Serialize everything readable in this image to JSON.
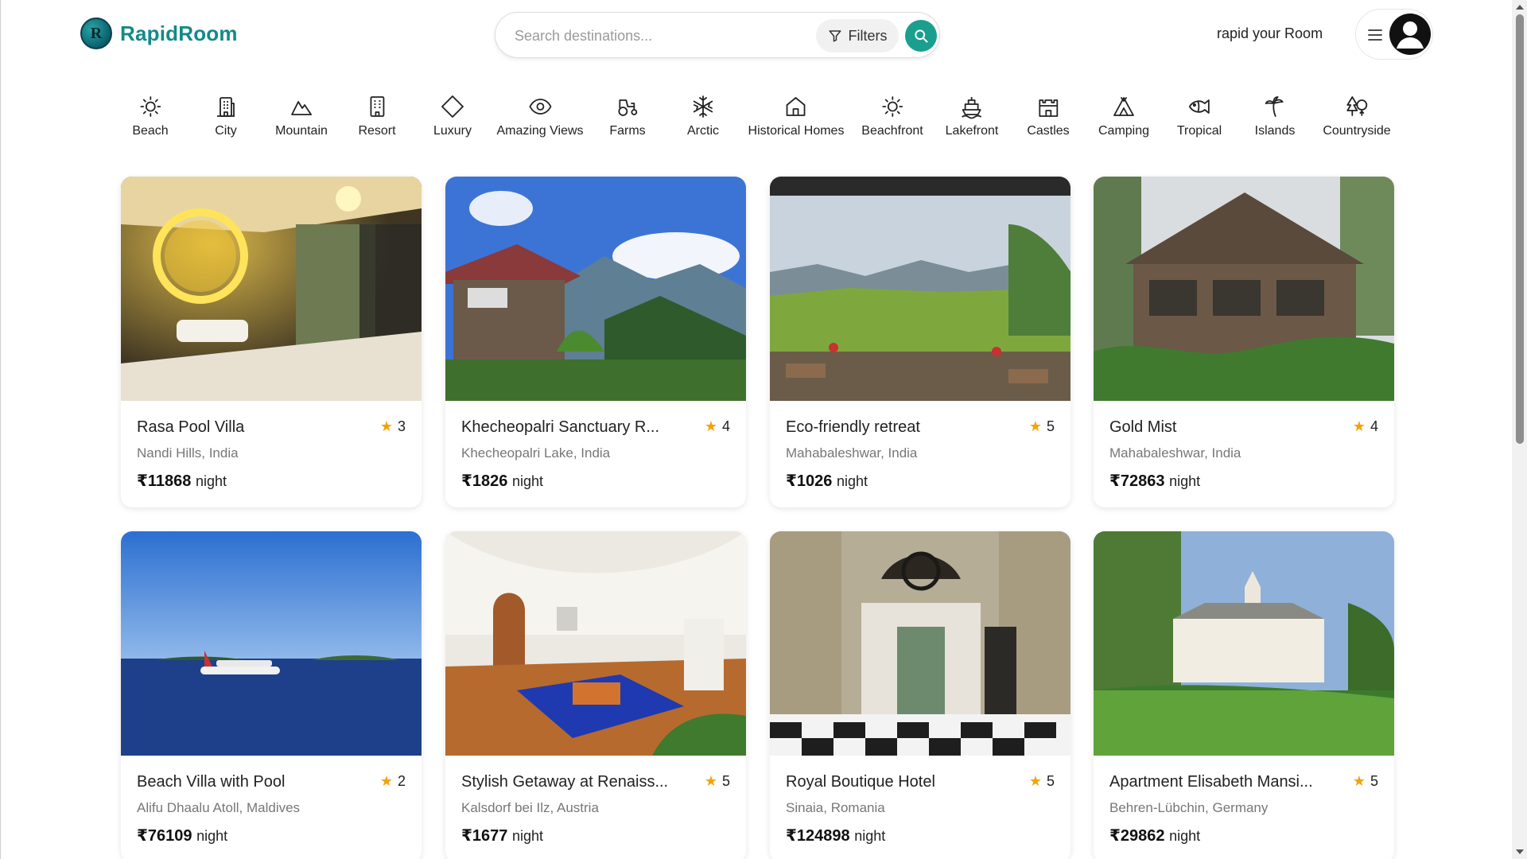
{
  "brand": {
    "name": "RapidRoom",
    "logo_letter": "R"
  },
  "search": {
    "placeholder": "Search destinations...",
    "filters_label": "Filters"
  },
  "header": {
    "tagline": "rapid your Room"
  },
  "categories": [
    {
      "label": "Beach",
      "icon": "sun-icon"
    },
    {
      "label": "City",
      "icon": "building-icon"
    },
    {
      "label": "Mountain",
      "icon": "mountain-icon"
    },
    {
      "label": "Resort",
      "icon": "hotel-icon"
    },
    {
      "label": "Luxury",
      "icon": "diamond-icon"
    },
    {
      "label": "Amazing Views",
      "icon": "eye-icon"
    },
    {
      "label": "Farms",
      "icon": "tractor-icon"
    },
    {
      "label": "Arctic",
      "icon": "snowflake-icon"
    },
    {
      "label": "Historical Homes",
      "icon": "home-icon"
    },
    {
      "label": "Beachfront",
      "icon": "sun-icon"
    },
    {
      "label": "Lakefront",
      "icon": "ship-icon"
    },
    {
      "label": "Castles",
      "icon": "castle-icon"
    },
    {
      "label": "Camping",
      "icon": "tent-icon"
    },
    {
      "label": "Tropical",
      "icon": "fish-icon"
    },
    {
      "label": "Islands",
      "icon": "palm-tree-icon"
    },
    {
      "label": "Countryside",
      "icon": "trees-icon"
    }
  ],
  "listings": [
    {
      "title": "Rasa Pool Villa",
      "location": "Nandi Hills, India",
      "price": "₹11868",
      "unit": "night",
      "rating": "3",
      "scene": "bathroom"
    },
    {
      "title": "Khecheopalri Sanctuary R...",
      "location": "Khecheopalri Lake, India",
      "price": "₹1826",
      "unit": "night",
      "rating": "4",
      "scene": "mountain-house"
    },
    {
      "title": "Eco-friendly retreat",
      "location": "Mahabaleshwar, India",
      "price": "₹1026",
      "unit": "night",
      "rating": "5",
      "scene": "valley"
    },
    {
      "title": "Gold Mist",
      "location": "Mahabaleshwar, India",
      "price": "₹72863",
      "unit": "night",
      "rating": "4",
      "scene": "wood-house"
    },
    {
      "title": "Beach Villa with Pool",
      "location": "Alifu Dhaalu Atoll, Maldives",
      "price": "₹76109",
      "unit": "night",
      "rating": "2",
      "scene": "sea"
    },
    {
      "title": "Stylish Getaway at Renaiss...",
      "location": "Kalsdorf bei Ilz, Austria",
      "price": "₹1677",
      "unit": "night",
      "rating": "5",
      "scene": "vault-room"
    },
    {
      "title": "Royal Boutique Hotel",
      "location": "Sinaia, Romania",
      "price": "₹124898",
      "unit": "night",
      "rating": "5",
      "scene": "chandelier-hall"
    },
    {
      "title": "Apartment Elisabeth Mansi...",
      "location": "Behren-Lübchin, Germany",
      "price": "₹29862",
      "unit": "night",
      "rating": "5",
      "scene": "mansion"
    }
  ],
  "colors": {
    "brand": "#138a87",
    "accent": "#1a9f8f",
    "star": "#f2a20a"
  }
}
